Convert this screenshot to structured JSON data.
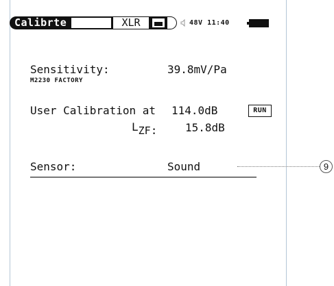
{
  "status_bar": {
    "mode_label": "Calibrte",
    "input_label": "XLR",
    "status_text": "48V 11:40",
    "icons": [
      "memory-icon",
      "speaker-icon",
      "battery-icon"
    ]
  },
  "sensitivity": {
    "label": "Sensitivity:",
    "value": "39.8mV/Pa",
    "source": "M2230 FACTORY"
  },
  "user_calibration": {
    "label": "User Calibration at",
    "value": "114.0dB",
    "run_label": "RUN",
    "lzf_prefix": "L",
    "lzf_subscript": "ZF",
    "lzf_suffix": ":",
    "lzf_value": "15.8dB"
  },
  "sensor": {
    "label": "Sensor:",
    "value": "Sound"
  },
  "callout": {
    "number": "9"
  }
}
